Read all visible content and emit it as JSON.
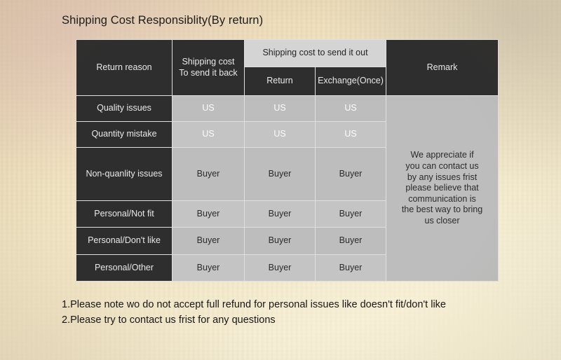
{
  "document": {
    "title": "Shipping Cost Responsiblity(By return)"
  },
  "table": {
    "headers": {
      "return_reason": "Return reason",
      "shipping_back_line1": "Shipping cost",
      "shipping_back_line2": "To send it back",
      "shipping_out_group": "Shipping cost to send it out",
      "shipping_out_return": "Return",
      "shipping_out_exchange": "Exchange(Once)",
      "remark": "Remark"
    },
    "rows": [
      {
        "reason": "Quality issues",
        "send_back": "US",
        "return": "US",
        "exchange": "US"
      },
      {
        "reason": "Quantity mistake",
        "send_back": "US",
        "return": "US",
        "exchange": "US"
      },
      {
        "reason": "Non-quanlity issues",
        "send_back": "Buyer",
        "return": "Buyer",
        "exchange": "Buyer"
      },
      {
        "reason": "Personal/Not fit",
        "send_back": "Buyer",
        "return": "Buyer",
        "exchange": "Buyer"
      },
      {
        "reason": "Personal/Don't like",
        "send_back": "Buyer",
        "return": "Buyer",
        "exchange": "Buyer"
      },
      {
        "reason": "Personal/Other",
        "send_back": "Buyer",
        "return": "Buyer",
        "exchange": "Buyer"
      }
    ],
    "remark_lines": [
      "We appreciate if",
      "you can contact us",
      "by any issues frist",
      "please believe that",
      "communication is",
      "the best way to bring",
      "us closer"
    ]
  },
  "notes": {
    "note1": "1.Please note wo do not accept full refund for personal issues like doesn't fit/don't like",
    "note2": "2.Please try to contact us frist for any questions"
  },
  "colors": {
    "header_dark": "#2e2e2e",
    "header_gray": "#d4d4d4",
    "cell_gray": "#bdbdbd",
    "paper": "#f3e8c8",
    "text_dark": "#1b1b1b",
    "text_light": "#e9e9e9"
  }
}
